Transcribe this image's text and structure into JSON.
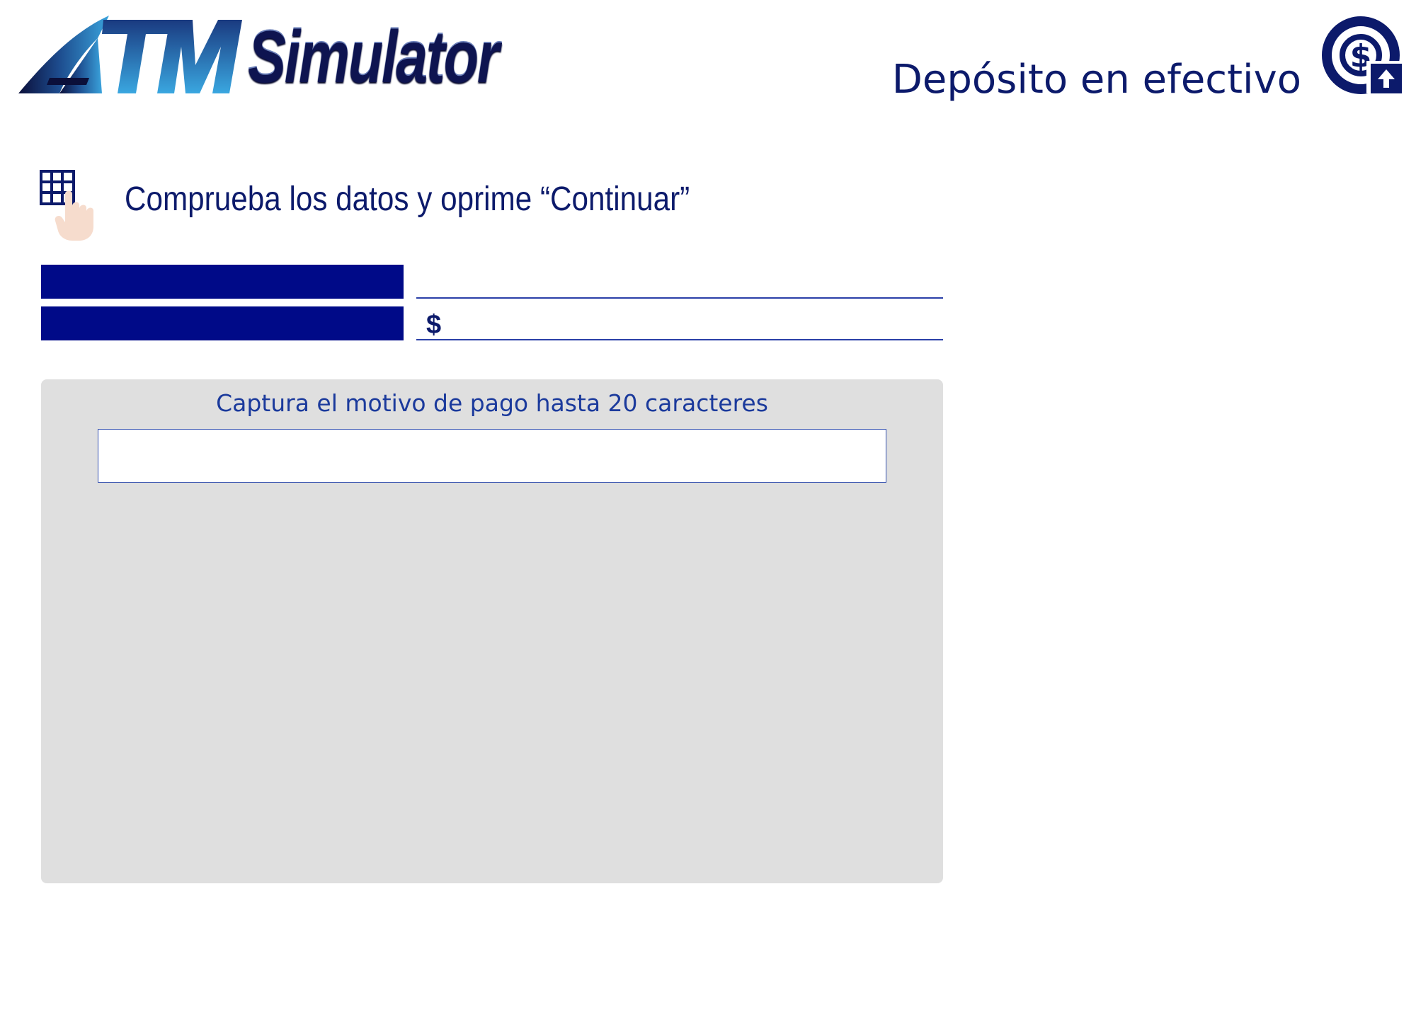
{
  "header": {
    "logo": {
      "word_atm": "ATM",
      "word_simulator": "Simulator"
    },
    "screen_title": "Depósito en efectivo",
    "deposit_icon": "cash-deposit-icon"
  },
  "instruction": {
    "icon": "keypad-hand-icon",
    "text": "Comprueba los datos y  oprime “Continuar”"
  },
  "data_rows": [
    {
      "label": "",
      "currency": "",
      "value": ""
    },
    {
      "label": "",
      "currency": "$",
      "value": ""
    }
  ],
  "capture": {
    "label": "Captura el motivo de pago hasta 20 caracteres",
    "value": "",
    "max_length": 20
  },
  "colors": {
    "navy": "#000a88",
    "title_text": "#0c1a6b",
    "capture_label": "#1b3a9c",
    "panel_bg": "#dfdfdf",
    "logo_gradient_dark": "#0e1450",
    "logo_gradient_light": "#3aa3dc"
  }
}
